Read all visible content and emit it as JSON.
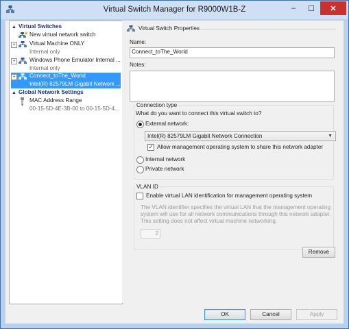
{
  "window": {
    "title": "Virtual Switch Manager for R9000W1B-Z",
    "icon": "virtual-switch-manager-icon"
  },
  "tree": {
    "virtual_switches_header": "Virtual Switches",
    "global_network_header": "Global Network Settings",
    "items": [
      {
        "label": "New virtual network switch",
        "sub": "",
        "icon": "new-switch-icon"
      },
      {
        "label": "Virtual Machine ONLY",
        "sub": "Internal only",
        "icon": "network-switch-icon"
      },
      {
        "label": "Windows Phone Emulator Internal ...",
        "sub": "Internal only",
        "icon": "network-switch-icon"
      },
      {
        "label": "Connect_toThe_World",
        "sub": "Intel(R) 82579LM Gigabit Network ...",
        "icon": "network-switch-icon"
      }
    ],
    "mac_item": {
      "label": "MAC Address Range",
      "sub": "00-15-5D-4E-3B-00 to 00-15-5D-4...",
      "icon": "mac-address-icon"
    }
  },
  "properties": {
    "title": "Virtual Switch Properties",
    "name_label": "Name:",
    "name_value": "Connect_toThe_World",
    "notes_label": "Notes:",
    "notes_value": "",
    "connection": {
      "legend": "Connection type",
      "question": "What do you want to connect this virtual switch to?",
      "external_label": "External network:",
      "adapter_selected": "Intel(R) 82579LM Gigabit Network Connection",
      "allow_mgmt_label": "Allow management operating system to share this network adapter",
      "allow_mgmt_checked": true,
      "internal_label": "Internal network",
      "private_label": "Private network",
      "selected": "external"
    },
    "vlan": {
      "legend": "VLAN ID",
      "enable_label": "Enable virtual LAN identification for management operating system",
      "enabled": false,
      "description": "The VLAN identifier specifies the virtual LAN that the management operating system will use for all network communications through this network adapter. This setting does not affect virtual machine networking.",
      "value": "2"
    },
    "remove_label": "Remove"
  },
  "footer": {
    "ok_label": "OK",
    "cancel_label": "Cancel",
    "apply_label": "Apply"
  }
}
